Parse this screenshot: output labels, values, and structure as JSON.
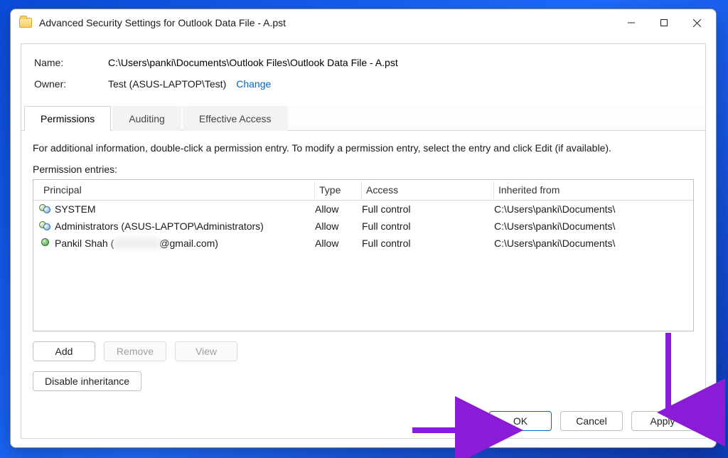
{
  "window": {
    "title": "Advanced Security Settings for Outlook Data File - A.pst"
  },
  "fields": {
    "name_label": "Name:",
    "name_value": "C:\\Users\\panki\\Documents\\Outlook Files\\Outlook Data File - A.pst",
    "owner_label": "Owner:",
    "owner_value": "Test (ASUS-LAPTOP\\Test)",
    "change_link": "Change"
  },
  "tabs": [
    {
      "label": "Permissions",
      "active": true
    },
    {
      "label": "Auditing",
      "active": false
    },
    {
      "label": "Effective Access",
      "active": false
    }
  ],
  "body": {
    "info": "For additional information, double-click a permission entry. To modify a permission entry, select the entry and click Edit (if available).",
    "entries_label": "Permission entries:",
    "columns": {
      "principal": "Principal",
      "type": "Type",
      "access": "Access",
      "inherited": "Inherited from"
    },
    "rows": [
      {
        "icon": "group",
        "principal": "SYSTEM",
        "type": "Allow",
        "access": "Full control",
        "inherited": "C:\\Users\\panki\\Documents\\"
      },
      {
        "icon": "group",
        "principal": "Administrators (ASUS-LAPTOP\\Administrators)",
        "type": "Allow",
        "access": "Full control",
        "inherited": "C:\\Users\\panki\\Documents\\"
      },
      {
        "icon": "single",
        "principal_prefix": "Pankil Shah (",
        "principal_blur": "xxxxxxxx",
        "principal_suffix": "@gmail.com)",
        "type": "Allow",
        "access": "Full control",
        "inherited": "C:\\Users\\panki\\Documents\\"
      }
    ]
  },
  "buttons": {
    "add": "Add",
    "remove": "Remove",
    "view": "View",
    "disable_inheritance": "Disable inheritance",
    "ok": "OK",
    "cancel": "Cancel",
    "apply": "Apply"
  }
}
